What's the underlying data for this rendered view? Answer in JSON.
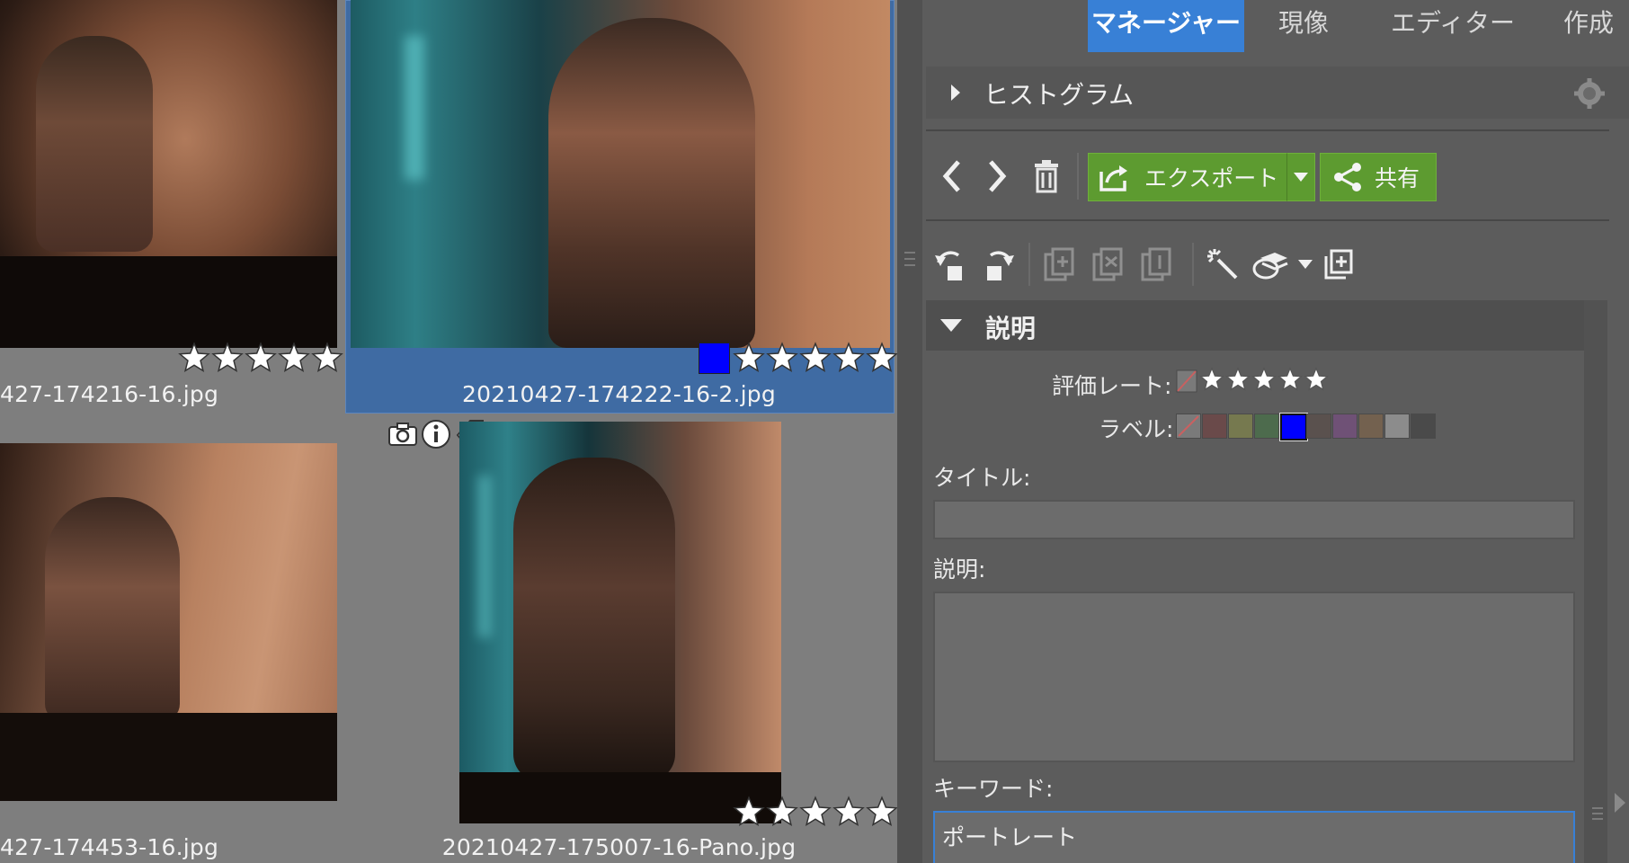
{
  "gallery": {
    "thumbnails": [
      {
        "filename": "427-174216-16.jpg",
        "rating": 5
      },
      {
        "filename": "20210427-174222-16-2.jpg",
        "rating": 5,
        "color_label": "#0000ff",
        "selected": true
      },
      {
        "filename": "427-174453-16.jpg"
      },
      {
        "filename": "20210427-175007-16-Pano.jpg",
        "rating": 5
      }
    ],
    "overlay_icons": [
      "camera-icon",
      "info-icon",
      "tag-icon"
    ]
  },
  "tabs": [
    {
      "label": "マネージャー",
      "active": true
    },
    {
      "label": "現像"
    },
    {
      "label": "エディター"
    },
    {
      "label": "作成"
    }
  ],
  "histogram": {
    "title": "ヒストグラム"
  },
  "toolbar": {
    "export_label": "エクスポート",
    "share_label": "共有",
    "icons": [
      "prev-icon",
      "next-icon",
      "trash-icon",
      "rotate-left-icon",
      "rotate-right-icon",
      "copy-icon",
      "delete-copy-icon",
      "copy-one-icon",
      "magic-wand-icon",
      "layers-icon",
      "add-page-icon"
    ]
  },
  "description_section": {
    "title": "説明",
    "rating_label": "評価レート:",
    "rating": 0,
    "label_label": "ラベル:",
    "label_colors": [
      "none",
      "#6a4a4a",
      "#76794f",
      "#4d6b4d",
      "#0000ff",
      "#5a514e",
      "#6f5176",
      "#73614f",
      "#8c8c8c",
      "#4a4a4a"
    ],
    "selected_label_index": 4,
    "title_label": "タイトル:",
    "title_value": "",
    "description_label": "説明:",
    "description_value": "",
    "keywords_label": "キーワード:",
    "keywords_value": "ポートレート"
  },
  "colors": {
    "accent": "#3880d6",
    "export_green": "#5d9b30",
    "selection_blue": "#3f6ba3"
  }
}
